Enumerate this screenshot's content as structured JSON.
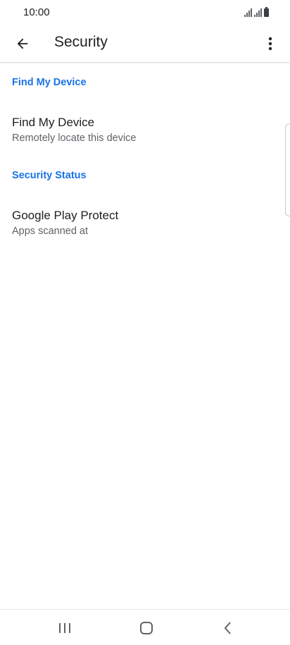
{
  "status_bar": {
    "time": "10:00",
    "icons": [
      "signal-icon",
      "signal-icon",
      "battery-icon"
    ]
  },
  "app_bar": {
    "title": "Security",
    "back_icon": "arrow-back-icon",
    "menu_icon": "more-vert-icon"
  },
  "sections": [
    {
      "header": "Find My Device",
      "items": [
        {
          "title": "Find My Device",
          "summary": "Remotely locate this device"
        }
      ]
    },
    {
      "header": "Security Status",
      "items": [
        {
          "title": "Google Play Protect",
          "summary": "Apps scanned at"
        }
      ]
    }
  ],
  "nav_bar": {
    "icons": [
      "recents-icon",
      "home-icon",
      "back-icon"
    ]
  },
  "colors": {
    "accent": "#1a73e8",
    "primary_text": "#202124",
    "secondary_text": "#5f6368"
  }
}
